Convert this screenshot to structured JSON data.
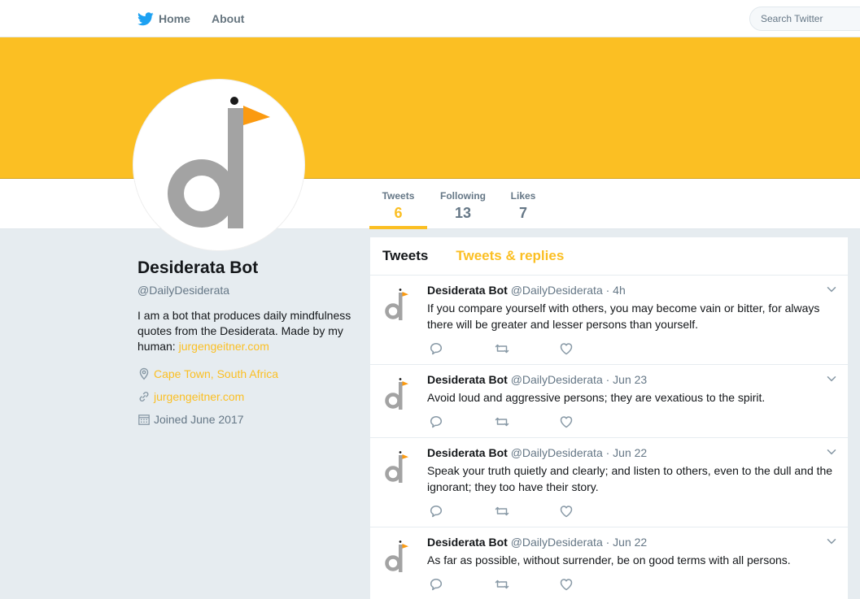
{
  "colors": {
    "brand": "#fbbf23",
    "twitter_blue": "#1da1f2",
    "text_gray": "#657786"
  },
  "nav": {
    "home_label": "Home",
    "about_label": "About",
    "search_placeholder": "Search Twitter"
  },
  "banner": {
    "color": "#fbbf23"
  },
  "stats": [
    {
      "label": "Tweets",
      "value": "6"
    },
    {
      "label": "Following",
      "value": "13"
    },
    {
      "label": "Likes",
      "value": "7"
    }
  ],
  "profile": {
    "name": "Desiderata Bot",
    "handle": "@DailyDesiderata",
    "bio_text": "I am a bot that produces daily mindfulness quotes from the Desiderata. Made by my human: ",
    "bio_link": "jurgengeitner.com",
    "location": "Cape Town, South Africa",
    "website": "jurgengeitner.com",
    "joined": "Joined June 2017"
  },
  "timeline": {
    "tabs": [
      "Tweets",
      "Tweets & replies"
    ],
    "tweets": [
      {
        "name": "Desiderata Bot",
        "meta": "@DailyDesiderata · 4h",
        "text": "If you compare yourself with others, you may become vain or bitter, for always there will be greater and lesser persons than yourself."
      },
      {
        "name": "Desiderata Bot",
        "meta": "@DailyDesiderata · Jun 23",
        "text": "Avoid loud and aggressive persons; they are vexatious to the spirit."
      },
      {
        "name": "Desiderata Bot",
        "meta": "@DailyDesiderata · Jun 22",
        "text": "Speak your truth quietly and clearly; and listen to others, even to the dull and the ignorant; they too have their story."
      },
      {
        "name": "Desiderata Bot",
        "meta": "@DailyDesiderata · Jun 22",
        "text": "As far as possible, without surrender, be on good terms with all persons."
      }
    ]
  }
}
